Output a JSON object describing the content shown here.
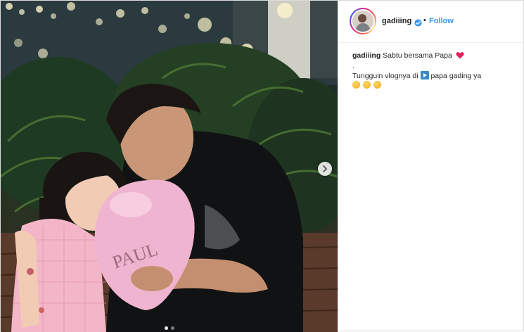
{
  "post": {
    "username": "gadiiing",
    "separator": "•",
    "follow_label": "Follow",
    "caption": {
      "line1": "Sabtu bersama Papa",
      "line2": ".",
      "line3_before": "Tungguin vlognya di",
      "line3_after": "papa gading ya"
    },
    "carousel": {
      "current": 1,
      "total": 2
    }
  },
  "icons": {
    "verified": "verified-badge-icon",
    "heart": "red-heart-icon",
    "play": "play-button-icon",
    "emoji": "flushed-face-emoji-icon",
    "next": "chevron-right-icon"
  },
  "colors": {
    "link_blue": "#3897f0",
    "text": "#262626",
    "heart_red": "#e0245e"
  }
}
